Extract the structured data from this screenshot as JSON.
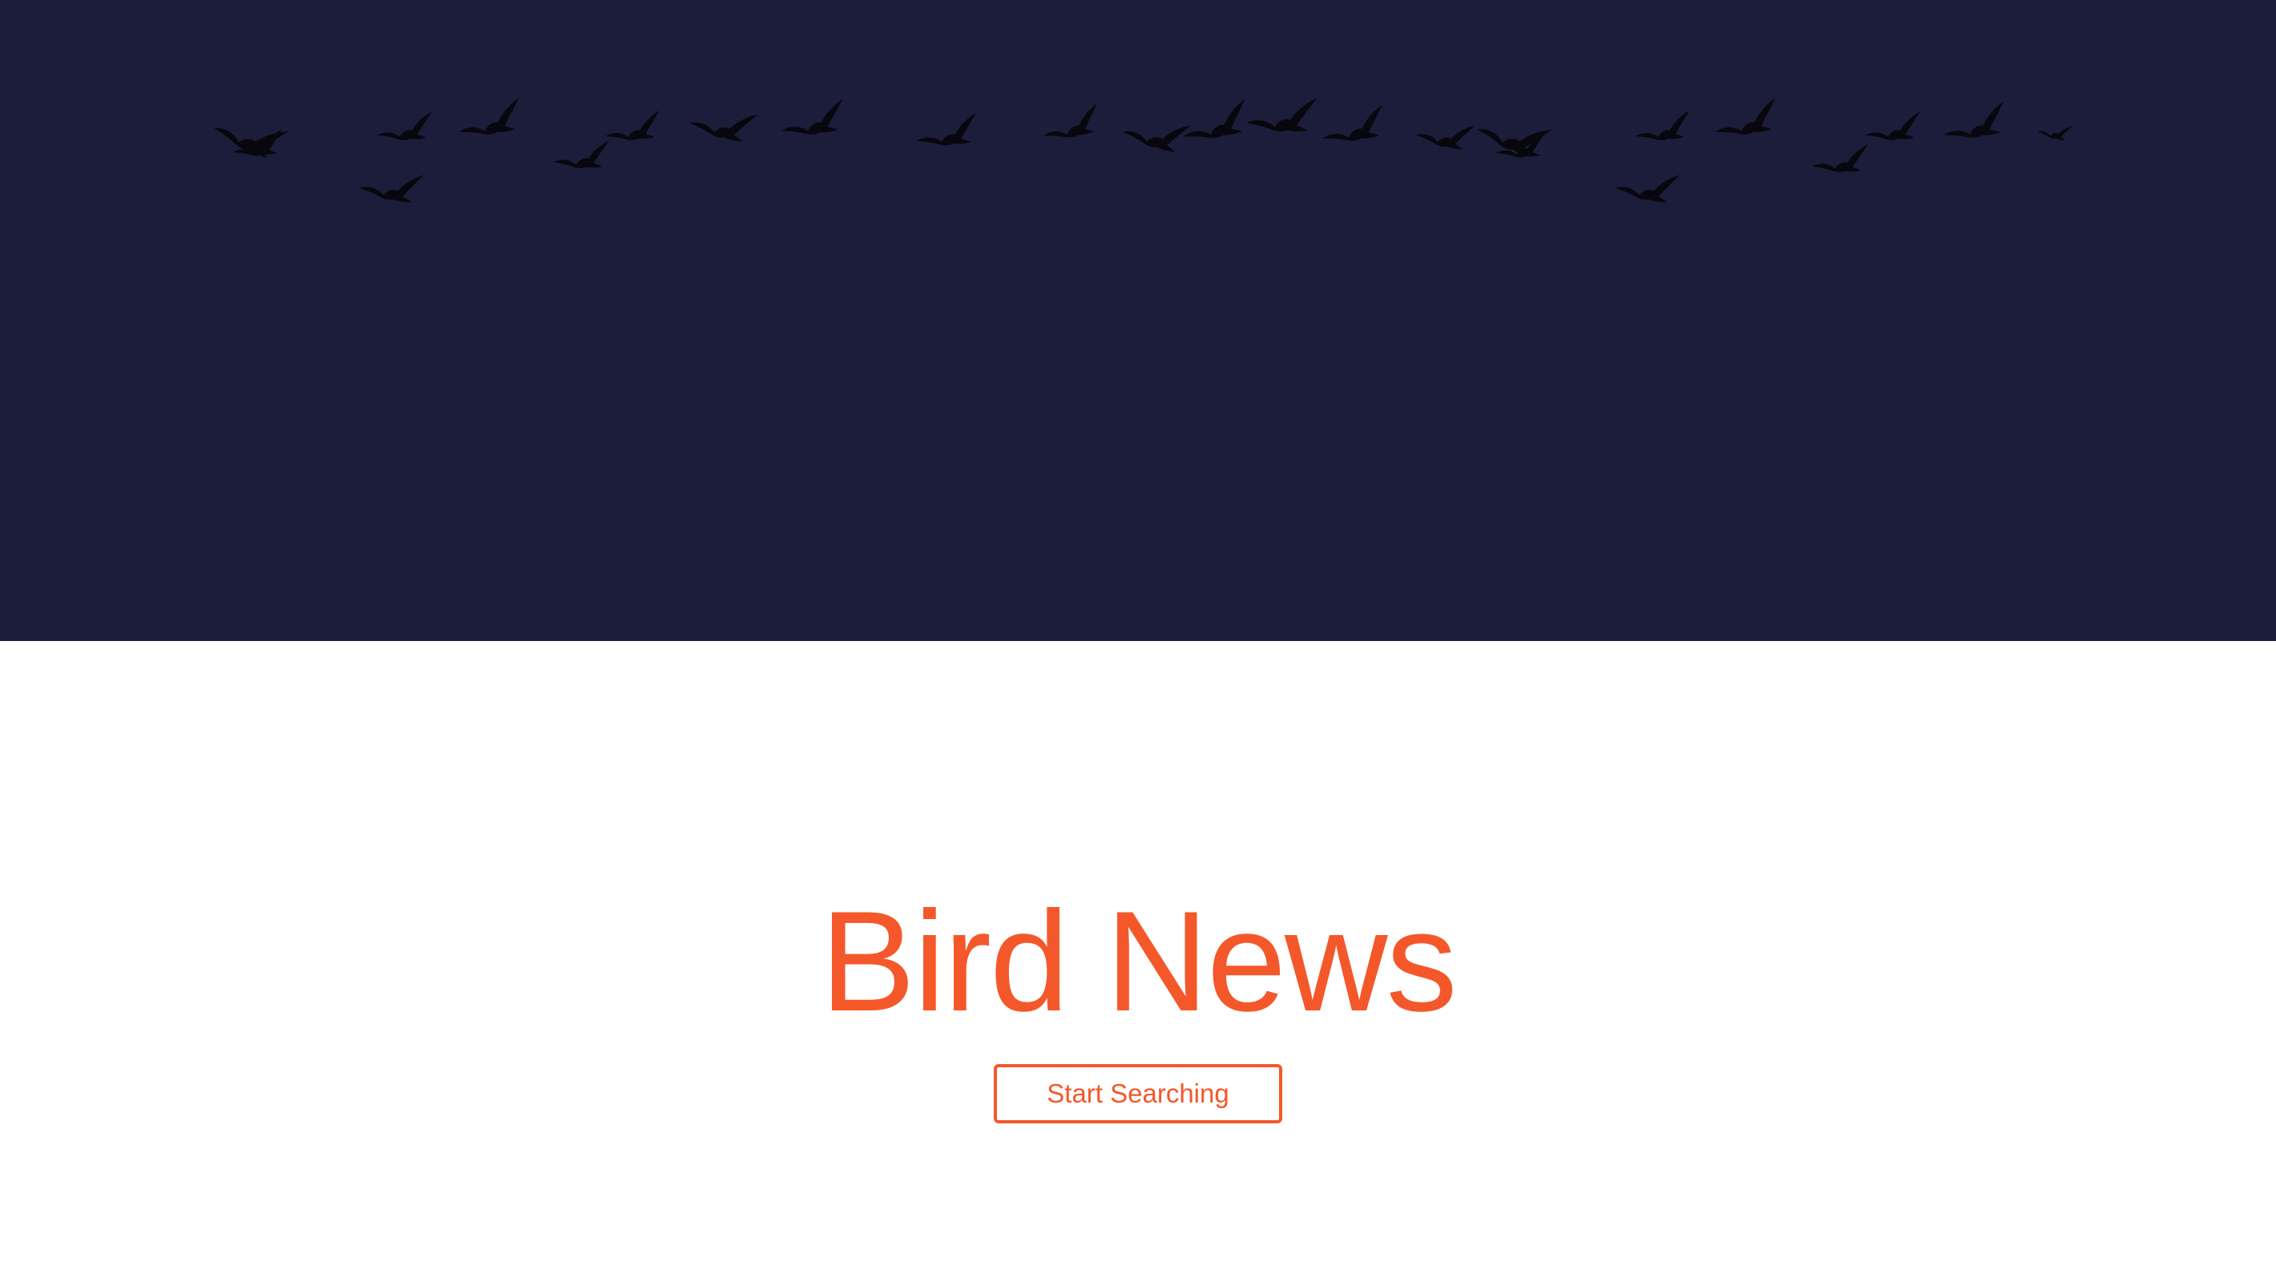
{
  "colors": {
    "banner_background": "#1c1d3a",
    "bird_silhouette": "#08070d",
    "accent": "#f4582a",
    "page_background": "#ffffff"
  },
  "hero": {
    "graphic": "flock-of-birds-silhouette"
  },
  "main": {
    "title": "Bird News",
    "cta_label": "Start Searching"
  }
}
